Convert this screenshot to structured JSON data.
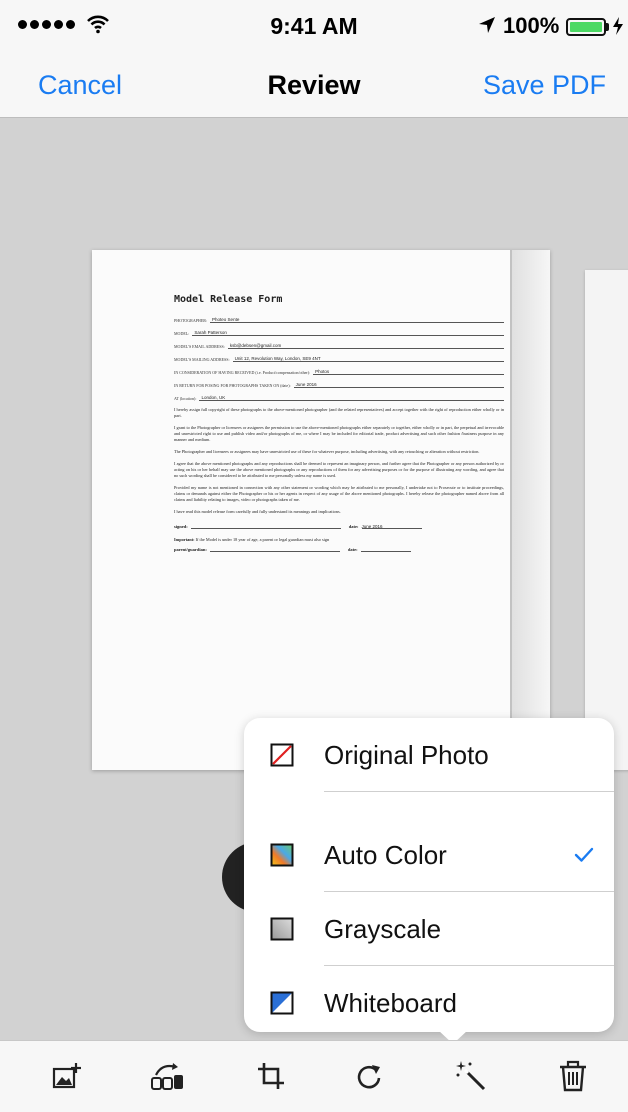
{
  "status_bar": {
    "time": "9:41 AM",
    "battery": "100%",
    "icons": [
      "signal-dots-icon",
      "wifi-icon",
      "location-arrow-icon",
      "battery-icon",
      "charging-bolt-icon"
    ]
  },
  "nav": {
    "cancel": "Cancel",
    "title": "Review",
    "save": "Save PDF"
  },
  "document": {
    "title": "Model Release Form",
    "fields": [
      {
        "label": "PHOTOGRAPHER:",
        "value": "Photeo Sente"
      },
      {
        "label": "MODEL:",
        "value": "Sarah Patterson"
      },
      {
        "label": "MODEL'S EMAIL ADDRESS:",
        "value": "ksb@debsen@gmail.com"
      },
      {
        "label": "MODEL'S MAILING ADDRESS:",
        "value": "Unit 12, Revolution Way, London, SE9 4NT"
      },
      {
        "label": "IN CONSIDERATION OF HAVING RECEIVED (i.e. Product/compensation/other):",
        "value": "Photos"
      },
      {
        "label": "IN RETURN FOR POSING FOR PHOTOGRAPHS TAKEN ON (date):",
        "value": "June 2016"
      },
      {
        "label": "AT (location):",
        "value": "London, UK"
      }
    ],
    "paragraphs": [
      "I hereby assign full copyright of these photographs to the above-mentioned photographer (and the related representatives) and accept together with the right of reproduction either wholly or in part.",
      "I grant to the Photographer or licensees or assignees the permission to use the above-mentioned photographs either separately or together, either wholly or in part, the perpetual and irrevocable and unrestricted right to use and publish video and/or photographs of me, or where I may be included for editorial trade, product advertising and such other fashion /business purpose in any manner and medium.",
      "The Photographer and licensees or assignees may have unrestricted use of these for whatever purpose, including advertising, with any retouching or alteration without restriction.",
      "I agree that the above mentioned photographs and any reproductions shall be deemed to represent an imaginary person, and further agree that the Photographer or any person authorized by or acting on his or her behalf may use the above mentioned photographs or any reproductions of them for any advertising purposes or for the purpose of illustrating any wording, and agree that no such wording shall be considered to be attributed to me personally unless my name is used.",
      "Provided my name is not mentioned in connection with any other statement or wording which may be attributed to me personally, I undertake not to Prosecute or to institute proceedings, claims or demands against either the Photographer or his or her agents in respect of any usage of the above mentioned photographs. I hereby release the photographer named above from all claims and liability relating to images, video or photographs taken of me.",
      "I have read this model release form carefully and fully understand its meanings and implications."
    ],
    "signed_label": "signed:",
    "date_label": "date:",
    "date_value": "June 2016",
    "important_label": "Important:",
    "important_text": "If the Model is under 18 year of age, a parent or legal guardian must also sign",
    "guardian_label": "parent/guardian:",
    "guardian_date_label": "date:"
  },
  "menu": {
    "items": [
      {
        "label": "Original Photo",
        "icon": "original-photo-icon",
        "selected": false
      },
      {
        "label": "Auto Color",
        "icon": "auto-color-icon",
        "selected": true
      },
      {
        "label": "Grayscale",
        "icon": "grayscale-icon",
        "selected": false
      },
      {
        "label": "Whiteboard",
        "icon": "whiteboard-icon",
        "selected": false
      }
    ],
    "check_icon": "checkmark-icon"
  },
  "toolbar": {
    "icons": [
      "add-page-icon",
      "filter-cars-icon",
      "crop-icon",
      "rotate-icon",
      "magic-wand-icon",
      "trash-icon"
    ]
  },
  "colors": {
    "accent": "#1a7cf2",
    "bar_background": "#f7f7f7",
    "canvas": "#d2d2d2",
    "battery_green": "#4cd964"
  }
}
